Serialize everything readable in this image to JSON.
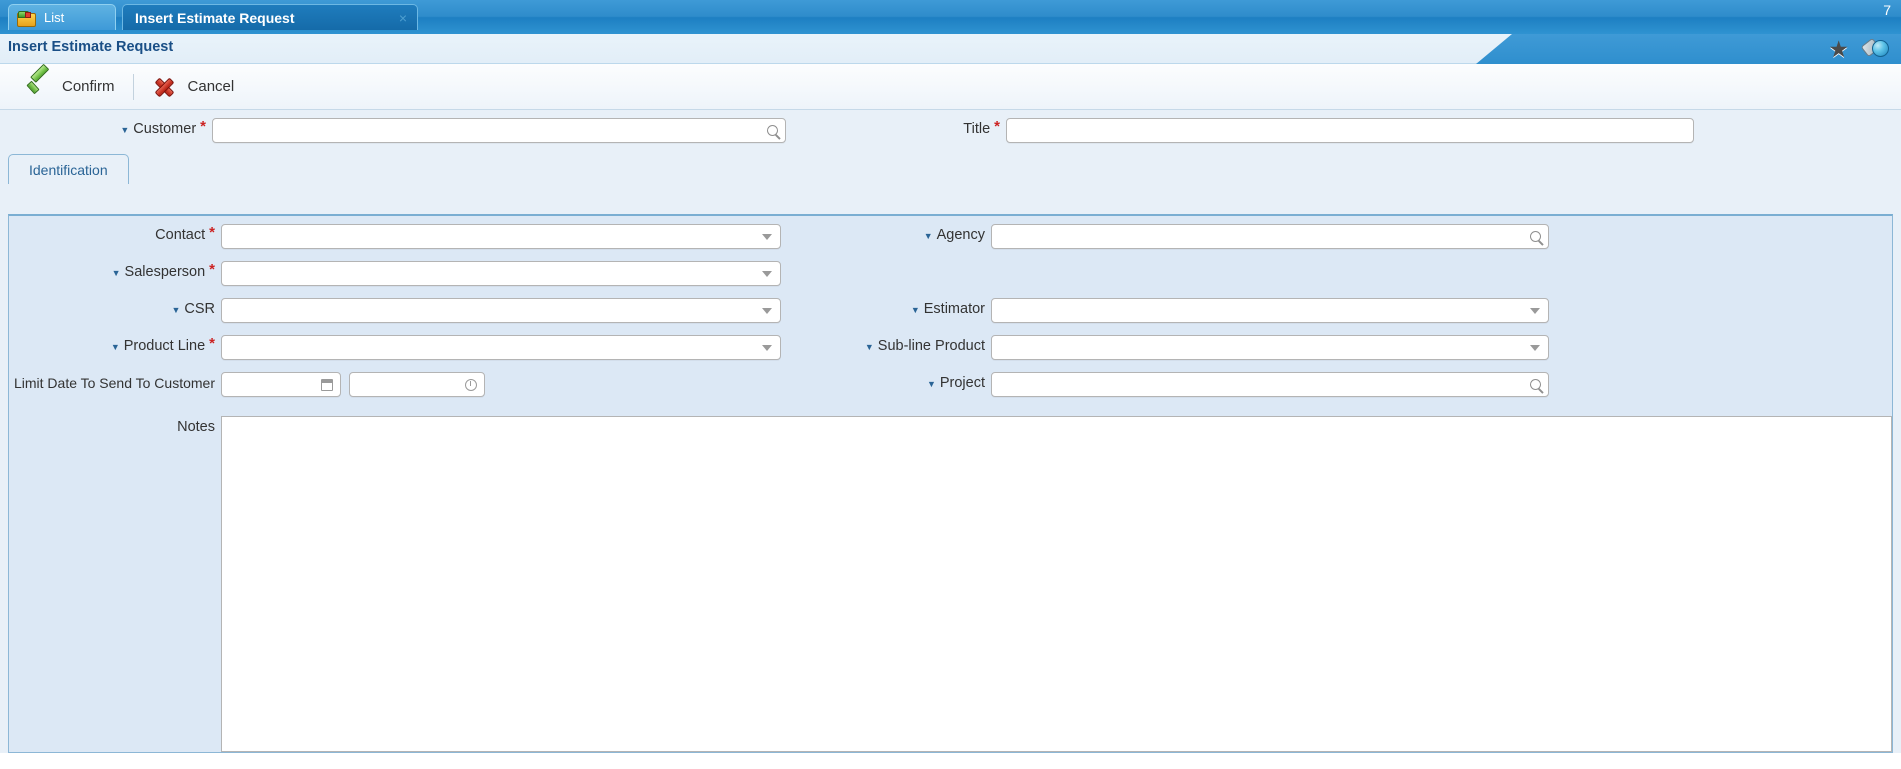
{
  "window": {
    "list_tab_label": "List",
    "active_tab_label": "Insert Estimate Request",
    "close_glyph": "×",
    "corner_number": "7",
    "star_glyph": "★"
  },
  "banner": {
    "title": "Insert Estimate Request"
  },
  "toolbar": {
    "confirm_label": "Confirm",
    "cancel_label": "Cancel"
  },
  "header_fields": {
    "customer": {
      "label": "Customer",
      "required": true,
      "caret": true,
      "value": "",
      "placeholder": ""
    },
    "title": {
      "label": "Title",
      "required": true,
      "caret": false,
      "value": "",
      "placeholder": ""
    }
  },
  "tabs": [
    {
      "label": "Identification",
      "active": true
    }
  ],
  "left_fields": [
    {
      "label": "Contact",
      "required": true,
      "caret": false,
      "value": "",
      "split": false,
      "button": "dropdown"
    },
    {
      "label": "Salesperson",
      "required": true,
      "caret": true,
      "value": "",
      "value2": "",
      "split": true,
      "button": "dropdown"
    },
    {
      "label": "CSR",
      "required": false,
      "caret": true,
      "value": "",
      "value2": "",
      "split": true,
      "button": "dropdown"
    },
    {
      "label": "Product Line",
      "required": true,
      "caret": true,
      "value": "",
      "split": false,
      "button": "dropdown"
    }
  ],
  "right_fields": [
    {
      "label": "Agency",
      "required": false,
      "caret": true,
      "value": "",
      "value2": "",
      "split": true,
      "button": "search"
    },
    {
      "label": "Estimator",
      "required": false,
      "caret": true,
      "value": "",
      "value2": "",
      "split": true,
      "button": "dropdown"
    },
    {
      "label": "Sub-line Product",
      "required": false,
      "caret": true,
      "value": "",
      "split": false,
      "button": "dropdown"
    },
    {
      "label": "Project",
      "required": false,
      "caret": true,
      "value": "",
      "value2": "",
      "split": true,
      "button": "search"
    }
  ],
  "limit_date": {
    "label": "Limit Date To Send To Customer",
    "date_value": "",
    "time_value": ""
  },
  "notes": {
    "label": "Notes",
    "value": "",
    "placeholder": ""
  },
  "colors": {
    "accent": "#2a6496",
    "titlebar": "#2e8ccb",
    "panel_bg": "#dce8f5",
    "form_bg": "#e8f0f8",
    "required": "#cc2222"
  }
}
